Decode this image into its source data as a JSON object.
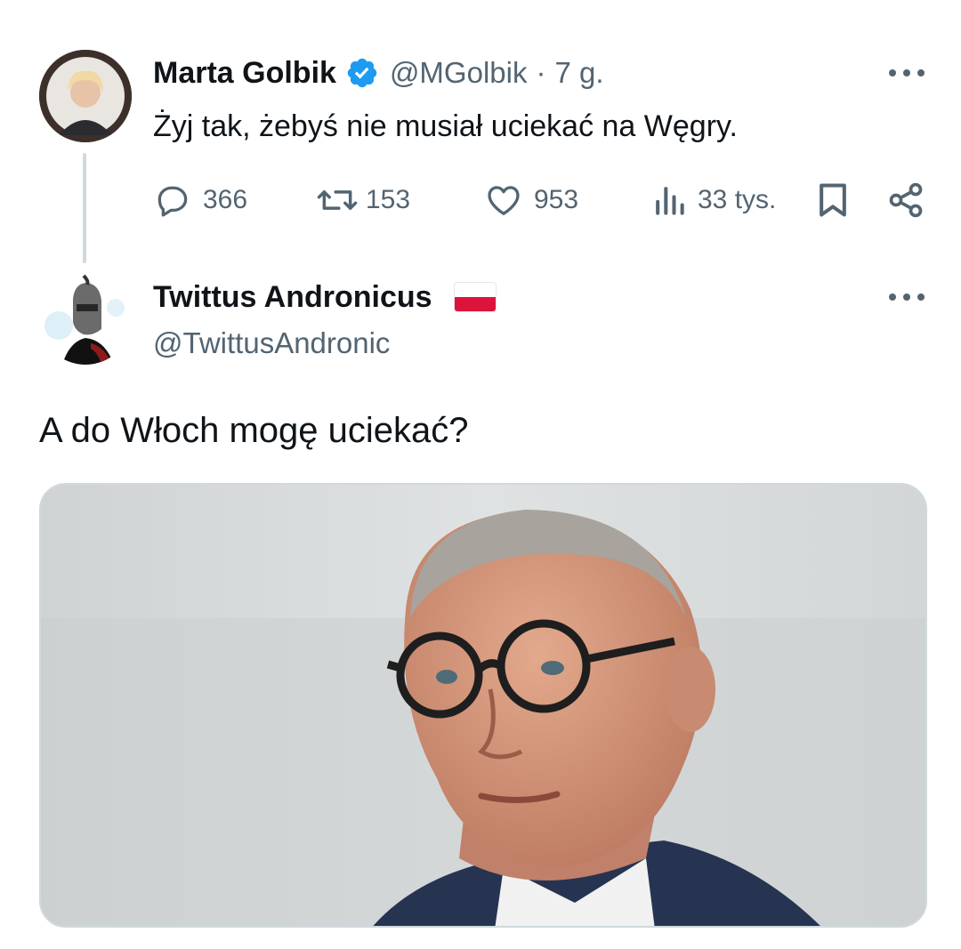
{
  "tweet1": {
    "author_name": "Marta Golbik",
    "author_handle": "@MGolbik",
    "separator": "·",
    "time": "7 g.",
    "text": "Żyj tak, żebyś nie musiał uciekać na Węgry.",
    "stats": {
      "replies": "366",
      "retweets": "153",
      "likes": "953",
      "views": "33 tys."
    },
    "icons": {
      "reply": "reply-bubble-icon",
      "retweet": "retweet-icon",
      "like": "heart-icon",
      "views": "views-bars-icon",
      "bookmark": "bookmark-icon",
      "share": "share-icon",
      "verified": "verified-badge-icon",
      "more": "more-dots-icon"
    }
  },
  "tweet2": {
    "author_name": "Twittus Andronicus",
    "author_handle": "@TwittusAndronic",
    "text": "A do Włoch mogę uciekać?",
    "name_decoration": "poland-flag-icon"
  },
  "colors": {
    "text": "#0f1419",
    "muted": "#536471",
    "verified": "#1d9bf0",
    "thread_line": "#cfd9de",
    "flag_red": "#dc143c"
  }
}
